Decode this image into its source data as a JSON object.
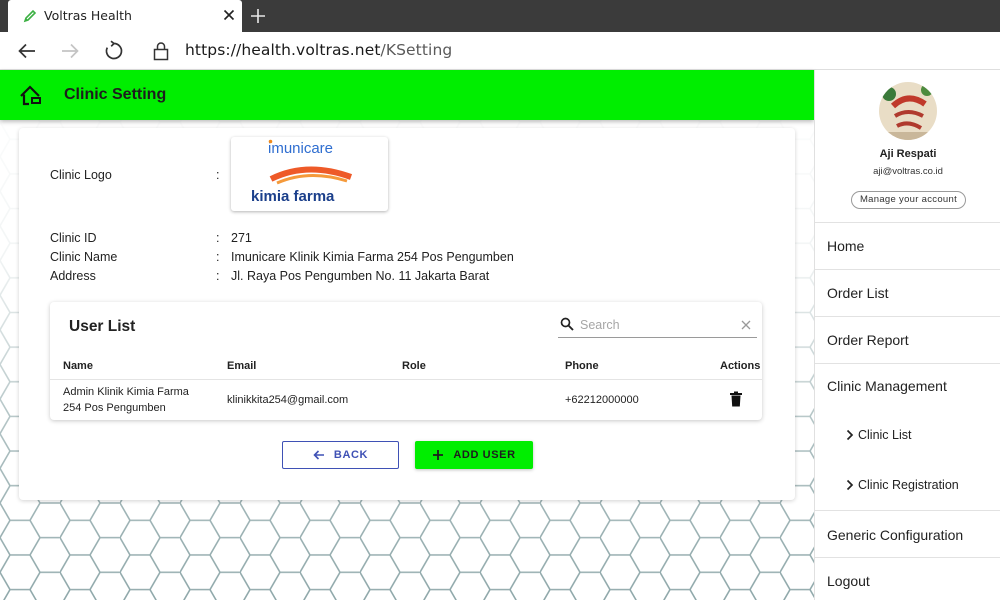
{
  "browser": {
    "tab_title": "Voltras Health",
    "url_host": "https://health.voltras.net",
    "url_path": "/KSetting"
  },
  "appbar": {
    "title": "Clinic Setting"
  },
  "clinic": {
    "logo_label": "Clinic Logo",
    "logo_text_top": "imunicare",
    "logo_text_bottom": "kimia farma",
    "fields": [
      {
        "label": "Clinic ID",
        "value": "271"
      },
      {
        "label": "Clinic Name",
        "value": "Imunicare Klinik Kimia Farma 254 Pos Pengumben"
      },
      {
        "label": "Address",
        "value": "Jl. Raya Pos Pengumben No. 11 Jakarta Barat"
      }
    ],
    "colon": ":"
  },
  "user_list": {
    "title": "User List",
    "search_placeholder": "Search",
    "columns": [
      "Name",
      "Email",
      "Role",
      "Phone",
      "Actions"
    ],
    "rows": [
      {
        "name_line1": "Admin Klinik Kimia Farma",
        "name_line2": "254 Pos Pengumben",
        "email": "klinikkita254@gmail.com",
        "role": "",
        "phone": "+62212000000"
      }
    ]
  },
  "buttons": {
    "back": "BACK",
    "add_user": "ADD USER"
  },
  "profile": {
    "name": "Aji Respati",
    "email": "aji@voltras.co.id",
    "manage": "Manage your account"
  },
  "menu": {
    "home": "Home",
    "order_list": "Order List",
    "order_report": "Order Report",
    "clinic_management": "Clinic Management",
    "clinic_list": "Clinic List",
    "clinic_registration": "Clinic Registration",
    "generic_configuration": "Generic Configuration",
    "logout": "Logout"
  },
  "colors": {
    "accent_green": "#00ee00",
    "button_blue": "#3f51b5"
  }
}
